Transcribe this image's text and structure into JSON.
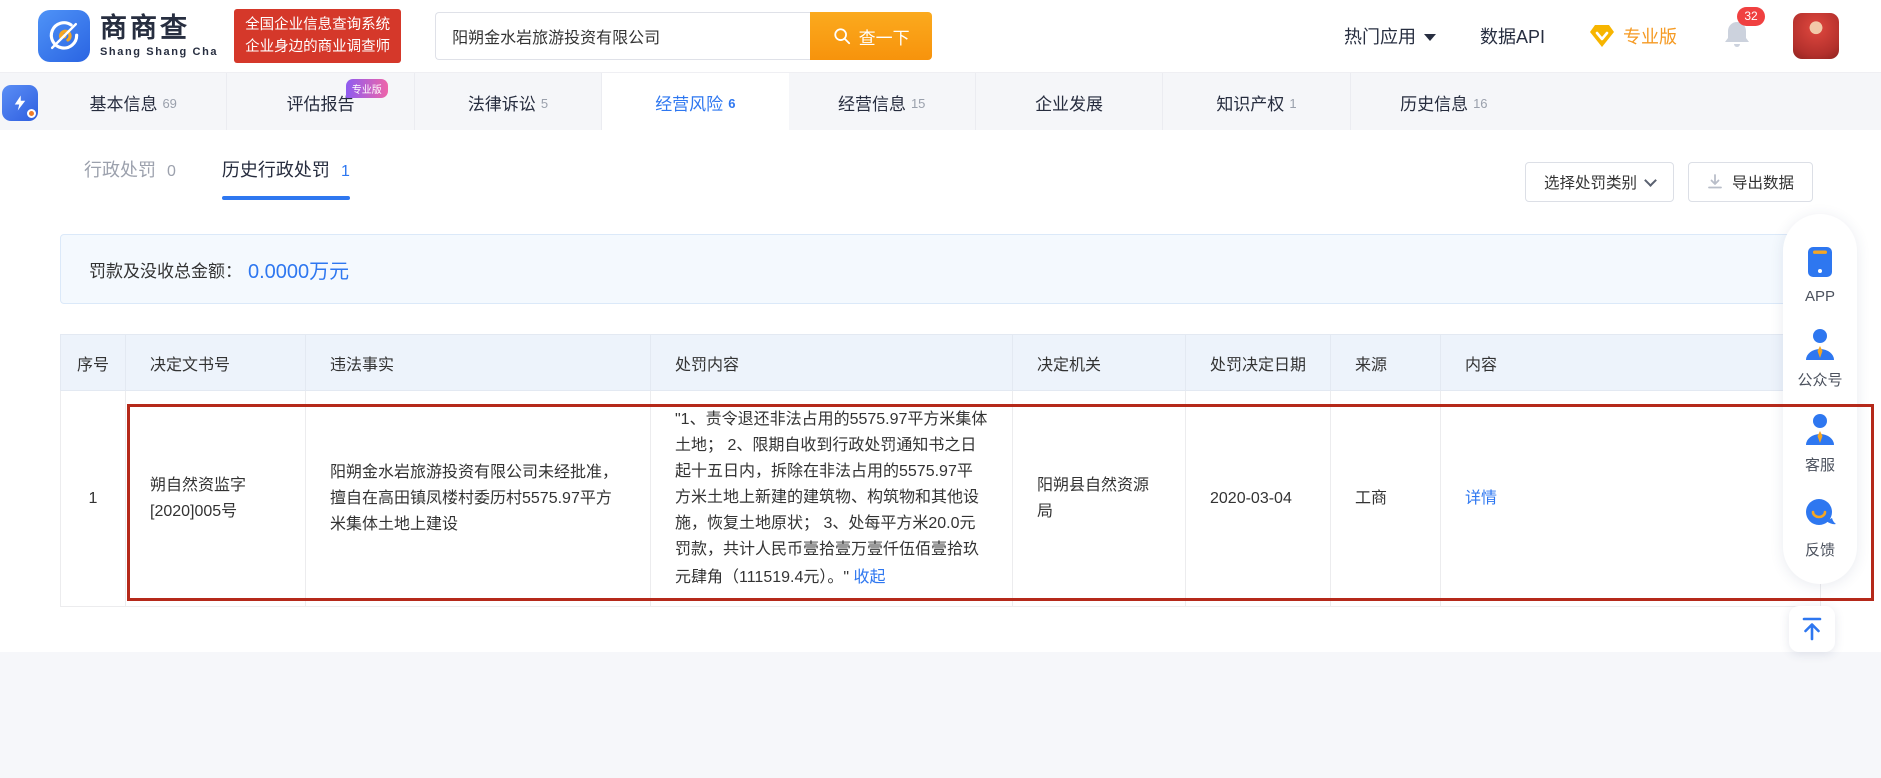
{
  "navbar": {
    "logo": {
      "title": "商商查",
      "subtitle": "Shang Shang Cha",
      "badge_line1": "全国企业信息查询系统",
      "badge_line2": "企业身边的商业调查师"
    },
    "search": {
      "value": "阳朔金水岩旅游投资有限公司",
      "button_label": "查一下"
    },
    "links": {
      "hot_apps": "热门应用",
      "data_api": "数据API",
      "pro": "专业版"
    },
    "notification_count": "32"
  },
  "tabs": {
    "items": [
      {
        "label": "基本信息",
        "count": "69"
      },
      {
        "label": "评估报告",
        "count": "",
        "badge": "专业版"
      },
      {
        "label": "法律诉讼",
        "count": "5"
      },
      {
        "label": "经营风险",
        "count": "6"
      },
      {
        "label": "经营信息",
        "count": "15"
      },
      {
        "label": "企业发展",
        "count": ""
      },
      {
        "label": "知识产权",
        "count": "1"
      },
      {
        "label": "历史信息",
        "count": "16"
      }
    ]
  },
  "subtabs": {
    "admin_penalty": {
      "label": "行政处罚",
      "count": "0"
    },
    "history_penalty": {
      "label": "历史行政处罚",
      "count": "1"
    },
    "filter_button": "选择处罚类别",
    "export_button": "导出数据"
  },
  "summary": {
    "label": "罚款及没收总金额：",
    "value": "0.0000万元"
  },
  "table": {
    "headers": [
      "序号",
      "决定文书号",
      "违法事实",
      "处罚内容",
      "决定机关",
      "处罚决定日期",
      "来源",
      "内容"
    ],
    "rows": [
      {
        "index": "1",
        "doc_no": "朔自然资监字[2020]005号",
        "violation": "阳朔金水岩旅游投资有限公司未经批准，擅自在高田镇凤楼村委历村5575.97平方米集体土地上建设",
        "penalty": "\"1、责令退还非法占用的5575.97平方米集体土地； 2、限期自收到行政处罚通知书之日起十五日内，拆除在非法占用的5575.97平方米土地上新建的建筑物、构筑物和其他设施，恢复土地原状； 3、处每平方米20.0元罚款，共计人民币壹拾壹万壹仟伍佰壹拾玖元肆角（111519.4元）。\"",
        "collapse_link": "收起",
        "authority": "阳朔县自然资源局",
        "decision_date": "2020-03-04",
        "source": "工商",
        "detail_link": "详情"
      }
    ]
  },
  "sidebar": {
    "items": [
      {
        "label": "APP"
      },
      {
        "label": "公众号"
      },
      {
        "label": "客服"
      },
      {
        "label": "反馈"
      }
    ]
  },
  "colors": {
    "accent": "#2e77f0",
    "annotation_red": "#b5291a",
    "orange": "#f59a23",
    "badge_red": "#d5382a"
  }
}
